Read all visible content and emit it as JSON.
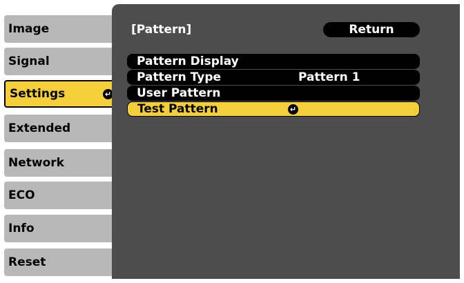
{
  "menu": {
    "items": [
      {
        "label": "Image"
      },
      {
        "label": "Signal"
      },
      {
        "label": "Settings"
      },
      {
        "label": "Extended"
      },
      {
        "label": "Network"
      },
      {
        "label": "ECO"
      },
      {
        "label": "Info"
      },
      {
        "label": "Reset"
      }
    ],
    "selected_index": 2,
    "enter_icon": "↵"
  },
  "panel": {
    "title": "[Pattern]",
    "return_label": "Return",
    "rows": [
      {
        "label": "Pattern Display",
        "value": ""
      },
      {
        "label": "Pattern Type",
        "value": "Pattern 1"
      },
      {
        "label": "User Pattern",
        "value": ""
      },
      {
        "label": "Test Pattern",
        "value": ""
      }
    ],
    "selected_row": 3,
    "enter_icon": "↵"
  },
  "colors": {
    "highlight": "#f5cf3a",
    "panel_bg": "#4d4d4d",
    "menu_bg": "#b8b8b8"
  }
}
